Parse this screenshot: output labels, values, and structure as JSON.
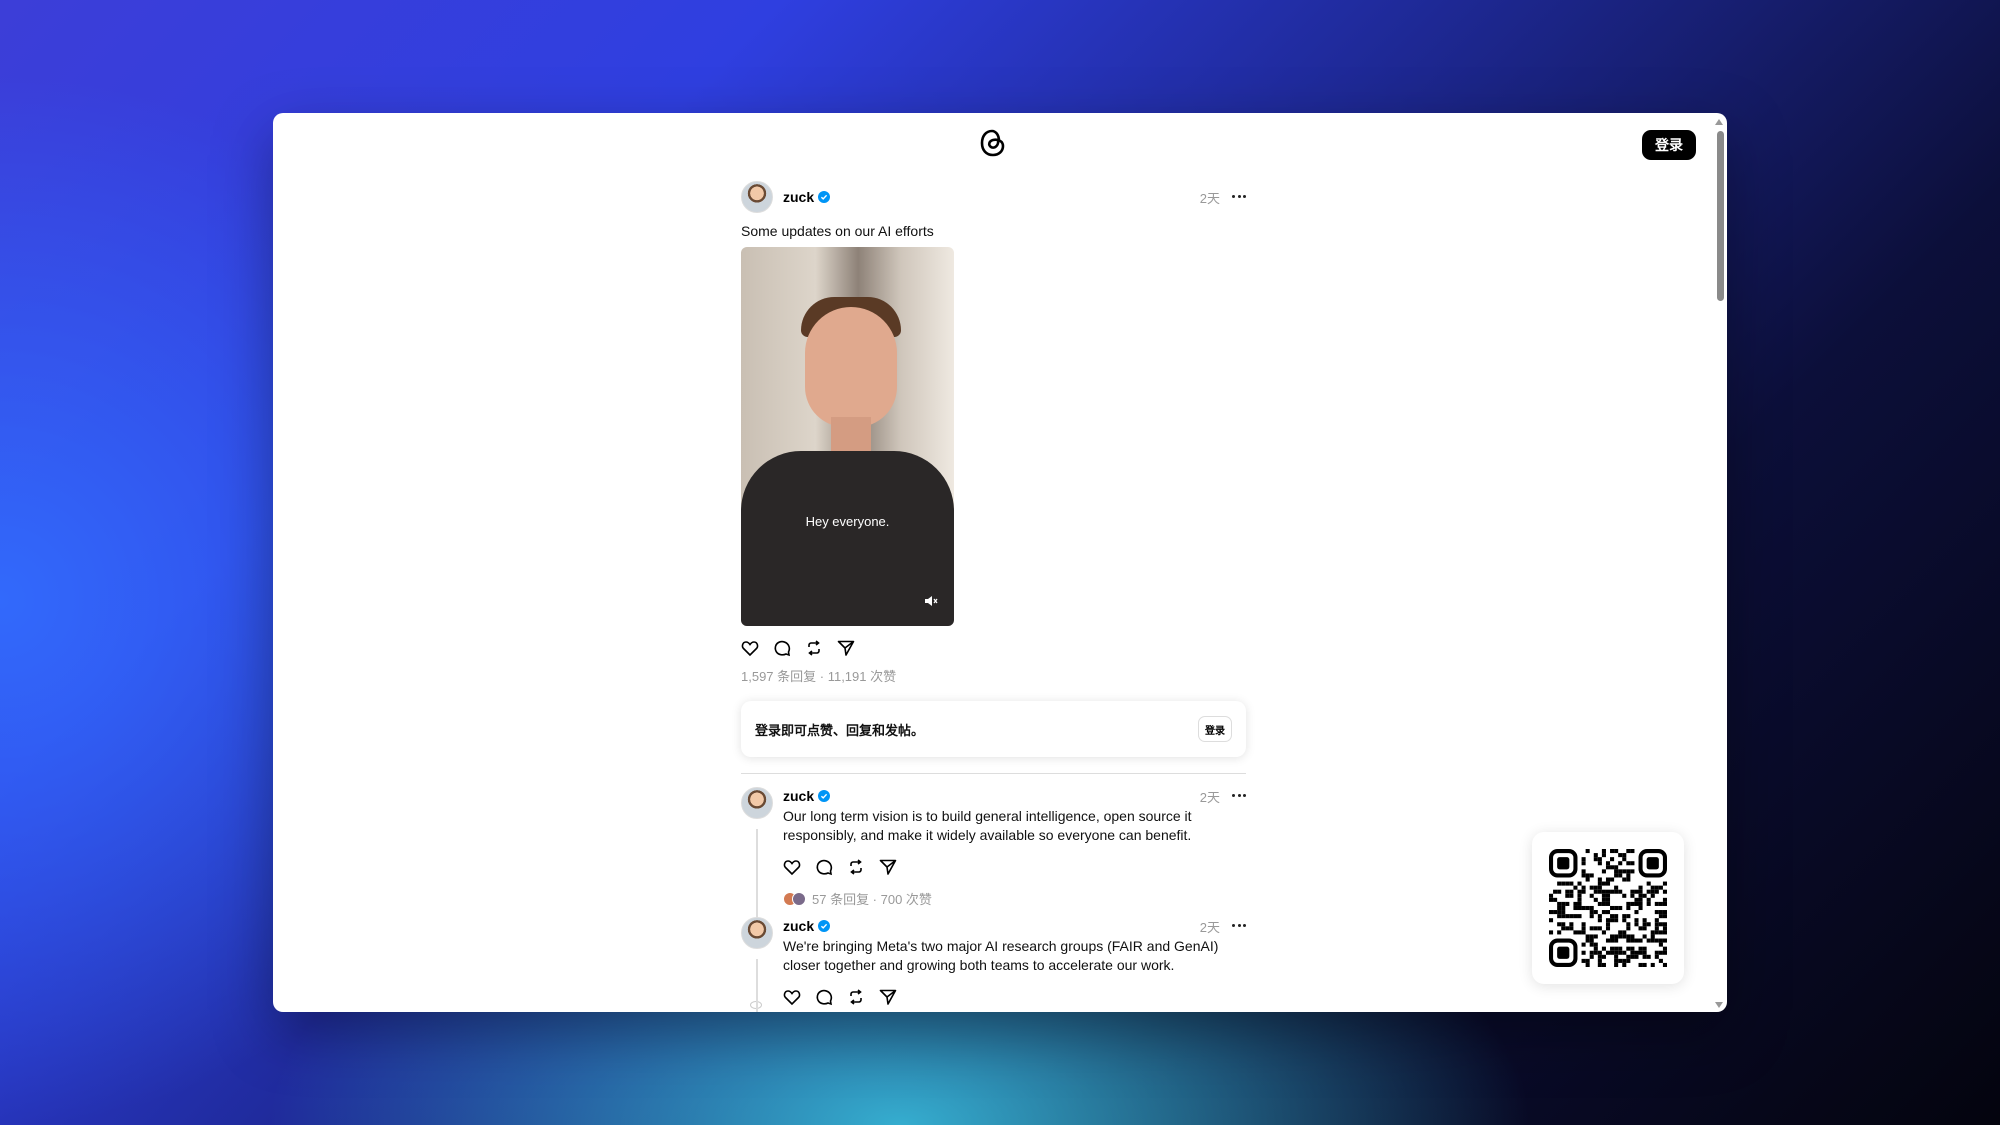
{
  "header": {
    "login_label": "登录"
  },
  "post": {
    "username": "zuck",
    "time": "2天",
    "text": "Some updates on our AI efforts",
    "video_caption": "Hey everyone.",
    "stats": "1,597 条回复 · 11,191 次赞"
  },
  "login_prompt": {
    "message": "登录即可点赞、回复和发帖。",
    "button_label": "登录"
  },
  "replies": [
    {
      "username": "zuck",
      "time": "2天",
      "text": "Our long term vision is to build general intelligence, open source it responsibly, and make it widely available so everyone can benefit.",
      "stats": "57 条回复 · 700 次赞"
    },
    {
      "username": "zuck",
      "time": "2天",
      "text": "We're bringing Meta's two major AI research groups (FAIR and GenAI) closer together and growing both teams to accelerate our work."
    }
  ],
  "icons": {
    "logo": "threads-logo-icon",
    "verified": "verified-badge-icon",
    "like": "heart-icon",
    "comment": "comment-icon",
    "repost": "repost-icon",
    "share": "share-icon",
    "more": "more-options-icon",
    "mute": "mute-icon",
    "qr": "qr-code-icon"
  },
  "colors": {
    "verified": "#0095f6",
    "button": "#000000"
  }
}
